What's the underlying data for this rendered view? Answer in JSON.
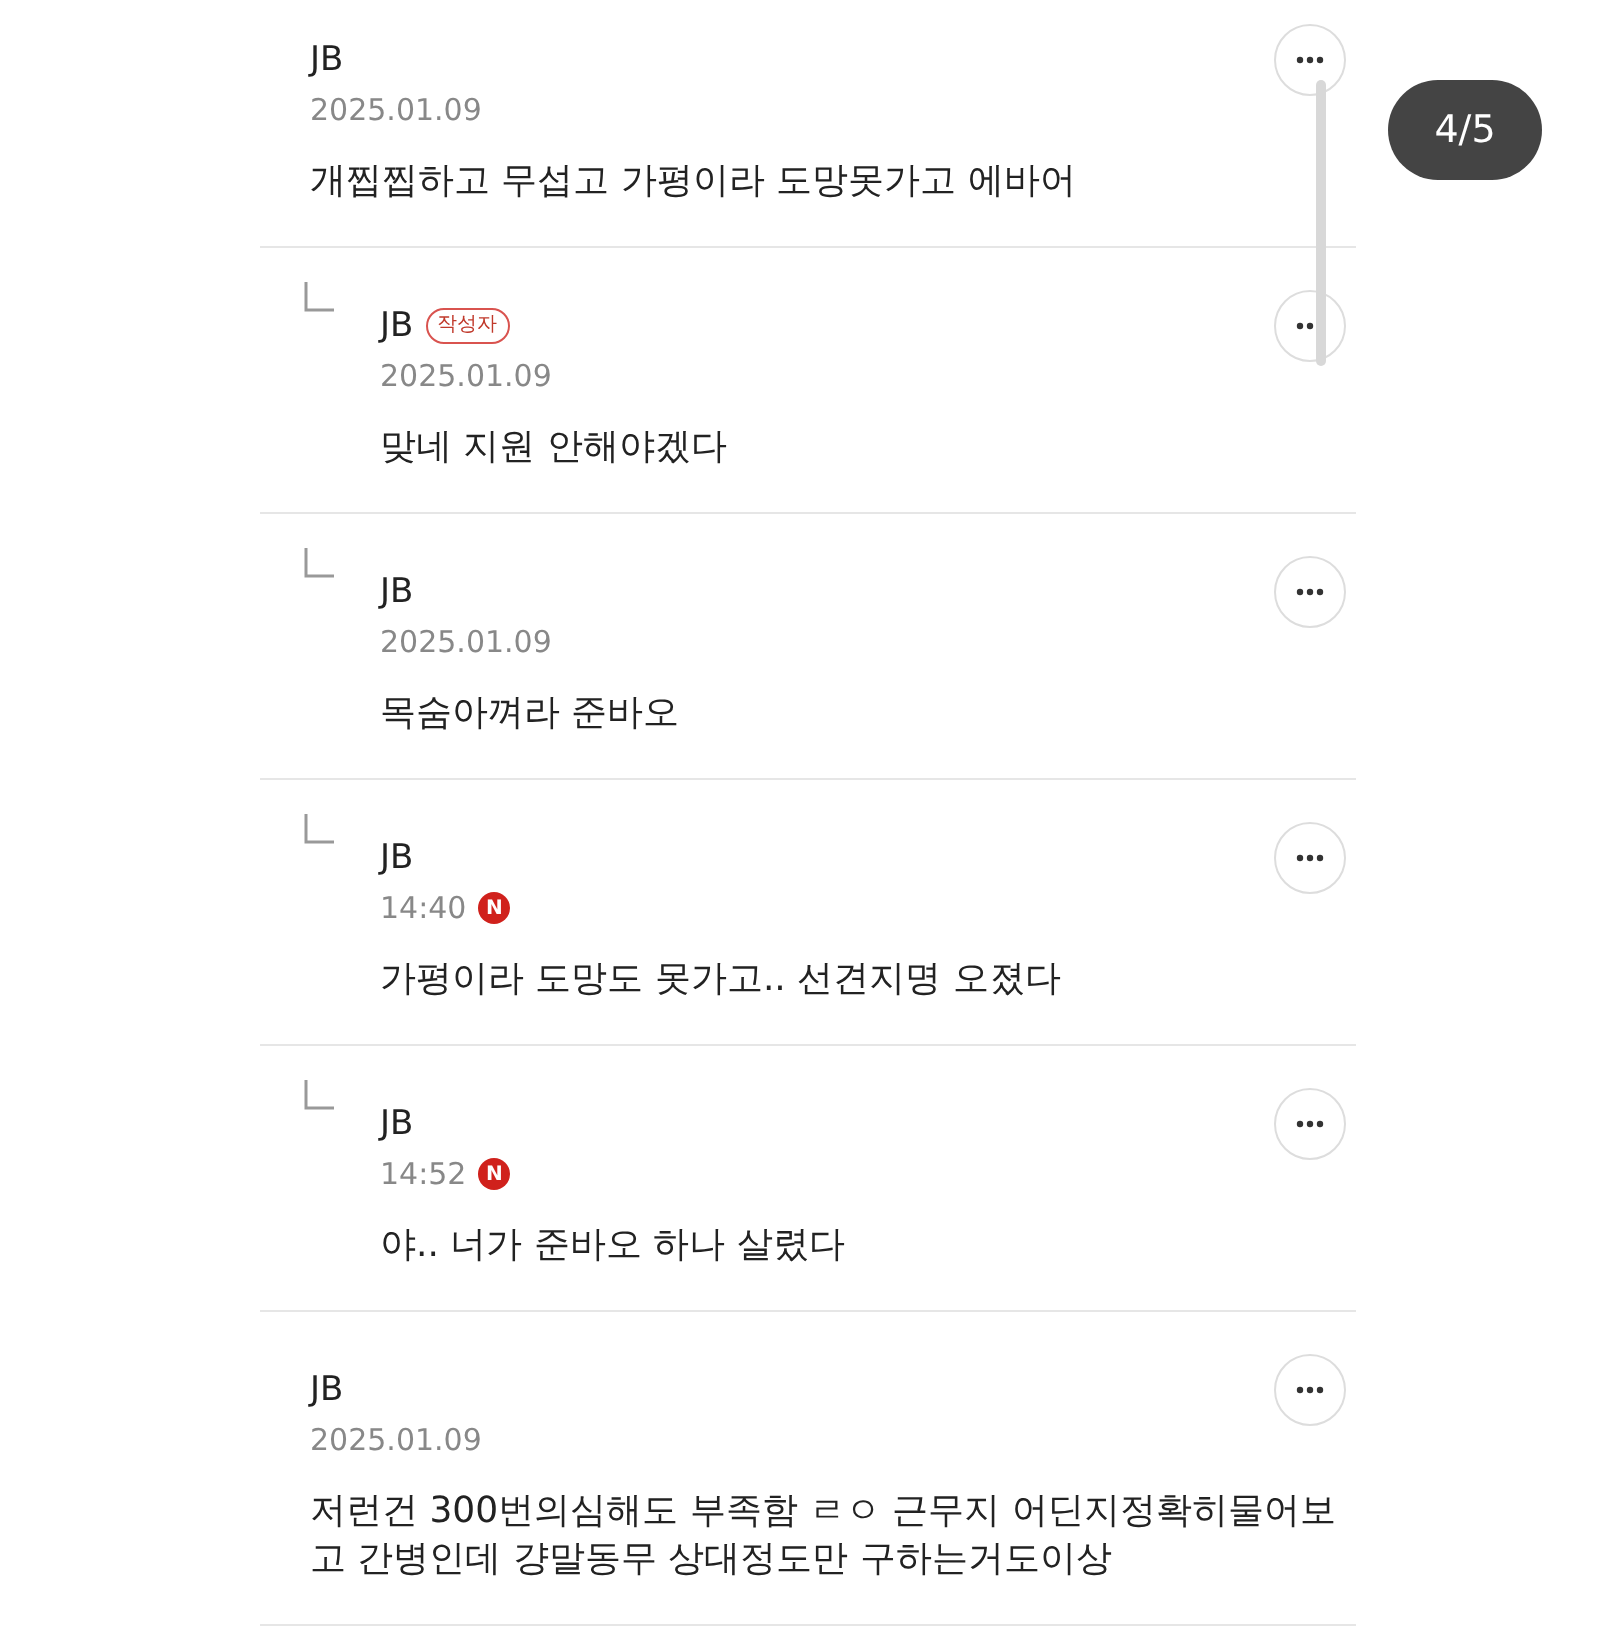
{
  "page_counter": "4/5",
  "comments": [
    {
      "author": "JB",
      "date": "2025.01.09",
      "text": "개찝찝하고 무섭고 가평이라 도망못가고 에바어",
      "children": [
        {
          "author": "JB",
          "author_badge": "작성자",
          "date": "2025.01.09",
          "text": "맞네 지원 안해야겠다"
        },
        {
          "author": "JB",
          "date": "2025.01.09",
          "text": "목숨아껴라 준바오"
        },
        {
          "author": "JB",
          "date": "14:40",
          "new_badge": "N",
          "text": "가평이라 도망도 못가고.. 선견지명 오졌다"
        },
        {
          "author": "JB",
          "date": "14:52",
          "new_badge": "N",
          "text": "야.. 너가 준바오 하나 살렸다"
        }
      ]
    },
    {
      "author": "JB",
      "date": "2025.01.09",
      "text": "저런건 300번의심해도 부족함 ㄹㅇ 근무지 어딘지정확히물어보고 간병인데 걍말동무 상대정도만 구하는거도이상"
    }
  ]
}
